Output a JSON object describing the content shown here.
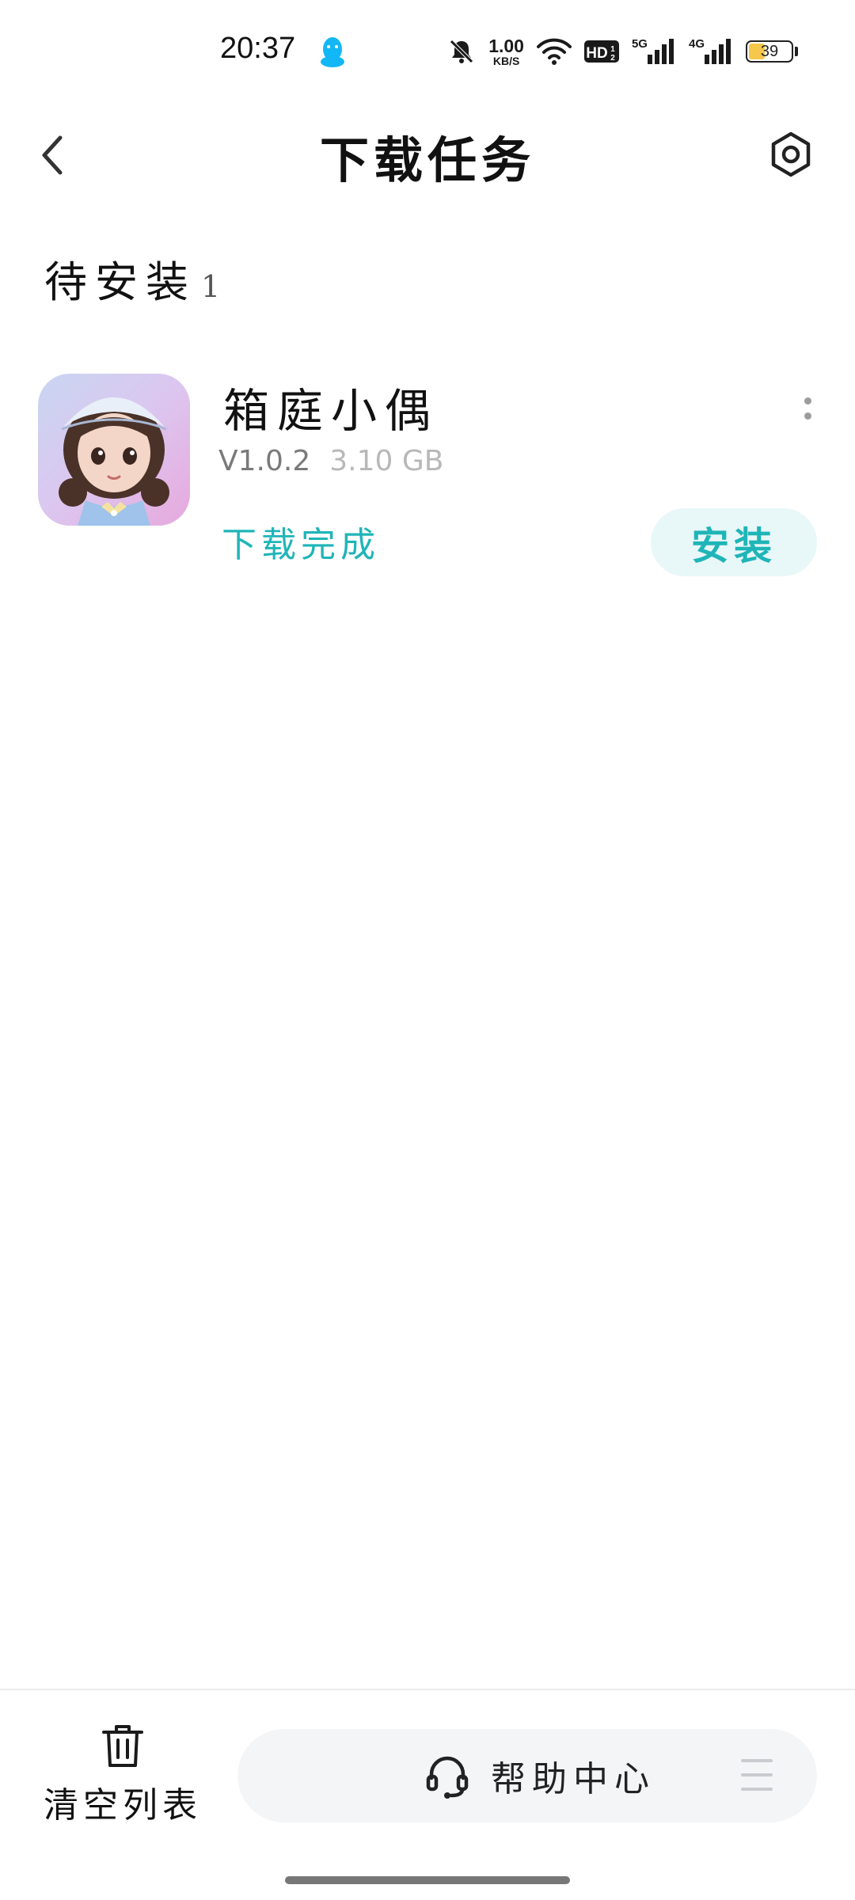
{
  "status_bar": {
    "time": "20:37",
    "net_speed_value": "1.00",
    "net_speed_unit": "KB/S",
    "hd_badge": "HD",
    "signal_5g": "5G",
    "signal_4g": "4G",
    "battery_level": "39",
    "battery_percent": 39,
    "icons": [
      "qq-icon",
      "mute-bell-icon",
      "wifi-icon",
      "hd-icon",
      "signal-5g-icon",
      "signal-4g-icon",
      "battery-icon"
    ]
  },
  "header": {
    "title": "下载任务",
    "back_icon": "back-chevron-icon",
    "settings_icon": "settings-icon"
  },
  "section": {
    "title": "待安装",
    "count": "1"
  },
  "downloads": [
    {
      "name": "箱庭小偶",
      "version": "V1.0.2",
      "size": "3.10 GB",
      "status": "下载完成",
      "action": "安装"
    }
  ],
  "footer": {
    "clear_label": "清空列表",
    "help_label": "帮助中心"
  },
  "colors": {
    "accent": "#1fb5b8",
    "accent_bg": "#e8f7f8",
    "help_bar_bg": "#f4f5f7"
  }
}
